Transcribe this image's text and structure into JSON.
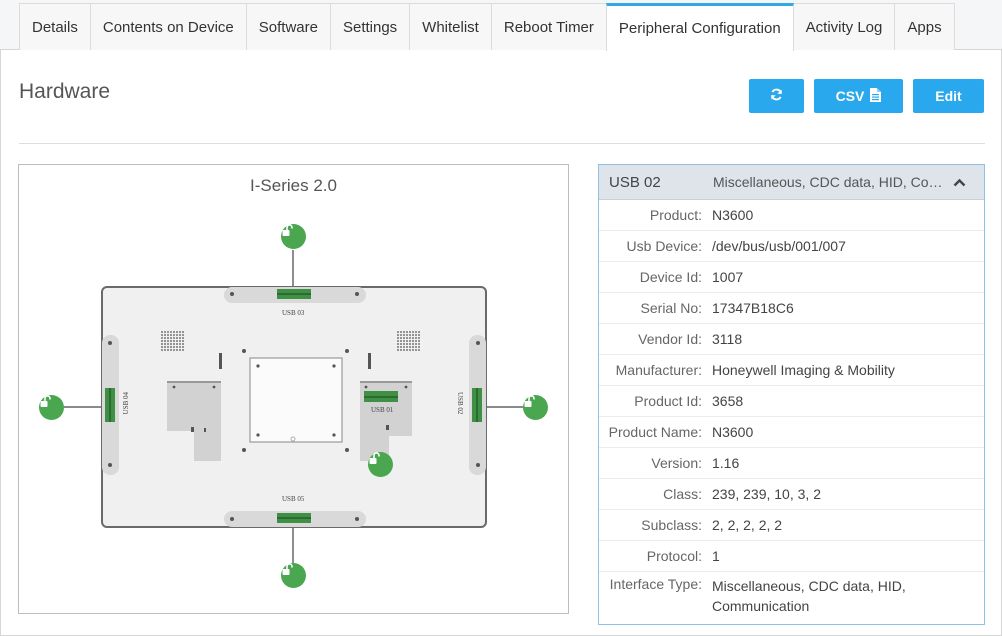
{
  "tabs": [
    {
      "label": "Details",
      "active": false
    },
    {
      "label": "Contents on Device",
      "active": false
    },
    {
      "label": "Software",
      "active": false
    },
    {
      "label": "Settings",
      "active": false
    },
    {
      "label": "Whitelist",
      "active": false
    },
    {
      "label": "Reboot Timer",
      "active": false
    },
    {
      "label": "Peripheral Configuration",
      "active": true
    },
    {
      "label": "Activity Log",
      "active": false
    },
    {
      "label": "Apps",
      "active": false
    }
  ],
  "header": {
    "title": "Hardware",
    "refresh_icon": "refresh-icon",
    "csv_label": "CSV",
    "csv_icon": "document-icon",
    "edit_label": "Edit"
  },
  "diagram": {
    "title": "I-Series 2.0",
    "ports": {
      "top": "USB 03",
      "left": "USB 04",
      "right": "USB 02",
      "center": "USB 01",
      "bottom": "USB 05"
    },
    "lock_icon": "unlock-icon",
    "lock_color": "#4aa64f",
    "port_color": "#4caf50"
  },
  "details": {
    "name": "USB 02",
    "summary": "Miscellaneous, CDC data, HID, Communication",
    "expanded": true,
    "rows": [
      {
        "key": "Product:",
        "value": "N3600"
      },
      {
        "key": "Usb Device:",
        "value": "/dev/bus/usb/001/007"
      },
      {
        "key": "Device Id:",
        "value": "1007"
      },
      {
        "key": "Serial No:",
        "value": "17347B18C6"
      },
      {
        "key": "Vendor Id:",
        "value": "3118"
      },
      {
        "key": "Manufacturer:",
        "value": "Honeywell Imaging & Mobility"
      },
      {
        "key": "Product Id:",
        "value": "3658"
      },
      {
        "key": "Product Name:",
        "value": "N3600"
      },
      {
        "key": "Version:",
        "value": "1.16"
      },
      {
        "key": "Class:",
        "value": "239, 239, 10, 3, 2"
      },
      {
        "key": "Subclass:",
        "value": "2, 2, 2, 2, 2"
      },
      {
        "key": "Protocol:",
        "value": "1"
      },
      {
        "key": "Interface Type:",
        "value": "Miscellaneous, CDC data, HID, Communication"
      }
    ]
  },
  "accent_color": "#2aa8ed"
}
